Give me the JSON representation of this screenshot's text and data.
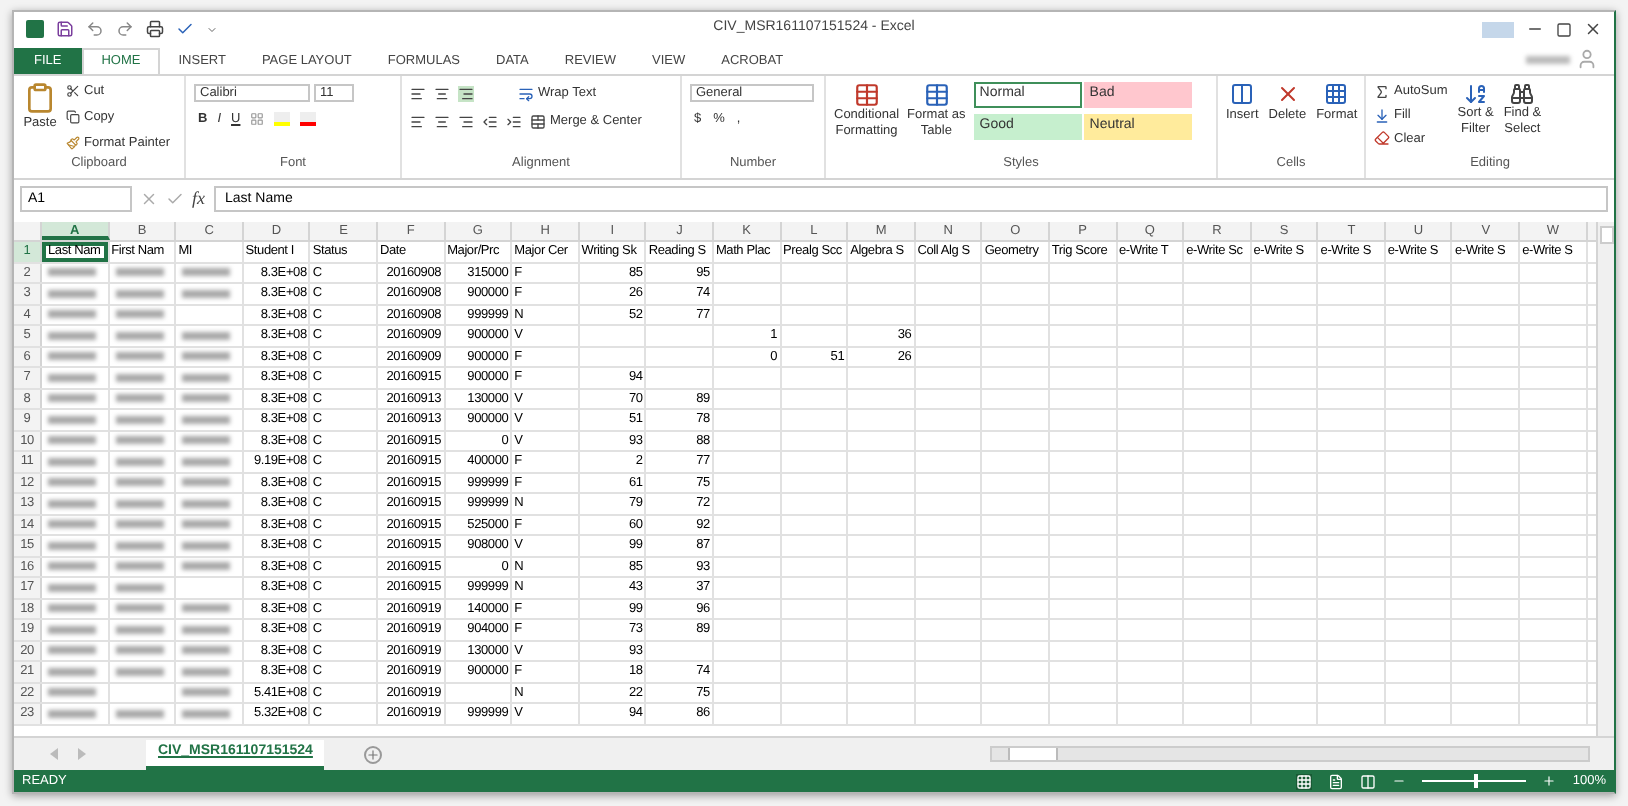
{
  "title_bar": {
    "title": "CIV_MSR161107151524 - Excel"
  },
  "ribbon_tabs": [
    {
      "label": "FILE",
      "kind": "file",
      "selected": false
    },
    {
      "label": "HOME",
      "kind": "tab",
      "selected": true
    },
    {
      "label": "INSERT",
      "kind": "tab",
      "selected": false
    },
    {
      "label": "PAGE LAYOUT",
      "kind": "tab",
      "selected": false
    },
    {
      "label": "FORMULAS",
      "kind": "tab",
      "selected": false
    },
    {
      "label": "DATA",
      "kind": "tab",
      "selected": false
    },
    {
      "label": "REVIEW",
      "kind": "tab",
      "selected": false
    },
    {
      "label": "VIEW",
      "kind": "tab",
      "selected": false
    },
    {
      "label": "ACROBAT",
      "kind": "tab",
      "selected": false
    }
  ],
  "clipboard": {
    "paste": "Paste",
    "cut": "Cut",
    "copy": "Copy",
    "format_painter": "Format Painter",
    "label": "Clipboard"
  },
  "font": {
    "name": "Calibri",
    "size": "11",
    "bold": "B",
    "italic": "I",
    "underline": "U",
    "label": "Font"
  },
  "alignment": {
    "wrap_text": "Wrap Text",
    "merge_center": "Merge & Center",
    "label": "Alignment"
  },
  "number": {
    "format": "General",
    "currency": "$",
    "percent": "%",
    "comma": ",",
    "label": "Number"
  },
  "styles": {
    "conditional": [
      "Conditional",
      "Formatting"
    ],
    "format_table": [
      "Format as",
      "Table"
    ],
    "label": "Styles",
    "cell_styles": [
      {
        "label": "Normal",
        "color": "#ffffff",
        "selected": true
      },
      {
        "label": "Bad",
        "color": "#ffc7ce",
        "selected": false
      },
      {
        "label": "Good",
        "color": "#c6efce",
        "selected": false
      },
      {
        "label": "Neutral",
        "color": "#ffeb9c",
        "selected": false
      }
    ]
  },
  "cells": {
    "buttons": [
      {
        "label": "Insert",
        "kind": "insert"
      },
      {
        "label": "Delete",
        "kind": "delete"
      },
      {
        "label": "Format",
        "kind": "format"
      }
    ],
    "label": "Cells"
  },
  "editing": {
    "autosum": "AutoSum",
    "fill": "Fill",
    "clear": "Clear",
    "sort": [
      "Sort &",
      "Filter"
    ],
    "find": [
      "Find &",
      "Select"
    ],
    "label": "Editing"
  },
  "formula_bar": {
    "name_box": "A1",
    "fx": "fx",
    "value": "Last Name"
  },
  "columns": [
    "A",
    "B",
    "C",
    "D",
    "E",
    "F",
    "G",
    "H",
    "I",
    "J",
    "K",
    "L",
    "M",
    "N",
    "O",
    "P",
    "Q",
    "R",
    "S",
    "T",
    "U",
    "V",
    "W"
  ],
  "header_row": {
    "num": "1",
    "cells": [
      {
        "text": "Last Nam",
        "selected": true
      },
      {
        "text": "First Nam",
        "selected": false
      },
      {
        "text": "MI",
        "selected": false
      },
      {
        "text": "Student I",
        "selected": false
      },
      {
        "text": "Status",
        "selected": false
      },
      {
        "text": "Date",
        "selected": false
      },
      {
        "text": "Major/Prc",
        "selected": false
      },
      {
        "text": "Major Cer",
        "selected": false
      },
      {
        "text": "Writing Sk",
        "selected": false
      },
      {
        "text": "Reading S",
        "selected": false
      },
      {
        "text": "Math Plac",
        "selected": false
      },
      {
        "text": "Prealg Scc",
        "selected": false
      },
      {
        "text": "Algebra S",
        "selected": false
      },
      {
        "text": "Coll Alg S",
        "selected": false
      },
      {
        "text": "Geometry",
        "selected": false
      },
      {
        "text": "Trig Score",
        "selected": false
      },
      {
        "text": "e-Write T",
        "selected": false
      },
      {
        "text": "e-Write Sc",
        "selected": false
      },
      {
        "text": "e-Write S",
        "selected": false
      },
      {
        "text": "e-Write S",
        "selected": false
      },
      {
        "text": "e-Write S",
        "selected": false
      },
      {
        "text": "e-Write S",
        "selected": false
      },
      {
        "text": "e-Write S",
        "selected": false
      }
    ]
  },
  "rows": [
    {
      "num": "2",
      "blur": [
        true,
        true,
        true
      ],
      "cells": {
        "D": "8.3E+08",
        "E": "C",
        "F": "20160908",
        "G": "315000",
        "H": "F",
        "I": "85",
        "J": "95"
      }
    },
    {
      "num": "3",
      "blur": [
        true,
        true,
        true
      ],
      "cells": {
        "D": "8.3E+08",
        "E": "C",
        "F": "20160908",
        "G": "900000",
        "H": "F",
        "I": "26",
        "J": "74"
      }
    },
    {
      "num": "4",
      "blur": [
        true,
        true,
        false
      ],
      "cells": {
        "D": "8.3E+08",
        "E": "C",
        "F": "20160908",
        "G": "999999",
        "H": "N",
        "I": "52",
        "J": "77"
      }
    },
    {
      "num": "5",
      "blur": [
        true,
        true,
        true
      ],
      "cells": {
        "D": "8.3E+08",
        "E": "C",
        "F": "20160909",
        "G": "900000",
        "H": "V",
        "K": "1",
        "M": "36"
      }
    },
    {
      "num": "6",
      "blur": [
        true,
        true,
        true
      ],
      "cells": {
        "D": "8.3E+08",
        "E": "C",
        "F": "20160909",
        "G": "900000",
        "H": "F",
        "K": "0",
        "L": "51",
        "M": "26"
      }
    },
    {
      "num": "7",
      "blur": [
        true,
        true,
        true
      ],
      "cells": {
        "D": "8.3E+08",
        "E": "C",
        "F": "20160915",
        "G": "900000",
        "H": "F",
        "I": "94"
      }
    },
    {
      "num": "8",
      "blur": [
        true,
        true,
        true
      ],
      "cells": {
        "D": "8.3E+08",
        "E": "C",
        "F": "20160913",
        "G": "130000",
        "H": "V",
        "I": "70",
        "J": "89"
      }
    },
    {
      "num": "9",
      "blur": [
        true,
        true,
        true
      ],
      "cells": {
        "D": "8.3E+08",
        "E": "C",
        "F": "20160913",
        "G": "900000",
        "H": "V",
        "I": "51",
        "J": "78"
      }
    },
    {
      "num": "10",
      "blur": [
        true,
        true,
        true
      ],
      "cells": {
        "D": "8.3E+08",
        "E": "C",
        "F": "20160915",
        "G": "0",
        "H": "V",
        "I": "93",
        "J": "88"
      }
    },
    {
      "num": "11",
      "blur": [
        true,
        true,
        true
      ],
      "cells": {
        "D": "9.19E+08",
        "E": "C",
        "F": "20160915",
        "G": "400000",
        "H": "F",
        "I": "2",
        "J": "77"
      }
    },
    {
      "num": "12",
      "blur": [
        true,
        true,
        true
      ],
      "cells": {
        "D": "8.3E+08",
        "E": "C",
        "F": "20160915",
        "G": "999999",
        "H": "F",
        "I": "61",
        "J": "75"
      }
    },
    {
      "num": "13",
      "blur": [
        true,
        true,
        true
      ],
      "cells": {
        "D": "8.3E+08",
        "E": "C",
        "F": "20160915",
        "G": "999999",
        "H": "N",
        "I": "79",
        "J": "72"
      }
    },
    {
      "num": "14",
      "blur": [
        true,
        true,
        true
      ],
      "cells": {
        "D": "8.3E+08",
        "E": "C",
        "F": "20160915",
        "G": "525000",
        "H": "F",
        "I": "60",
        "J": "92"
      }
    },
    {
      "num": "15",
      "blur": [
        true,
        true,
        true
      ],
      "cells": {
        "D": "8.3E+08",
        "E": "C",
        "F": "20160915",
        "G": "908000",
        "H": "V",
        "I": "99",
        "J": "87"
      }
    },
    {
      "num": "16",
      "blur": [
        true,
        true,
        true
      ],
      "cells": {
        "D": "8.3E+08",
        "E": "C",
        "F": "20160915",
        "G": "0",
        "H": "N",
        "I": "85",
        "J": "93"
      }
    },
    {
      "num": "17",
      "blur": [
        true,
        true,
        false
      ],
      "cells": {
        "D": "8.3E+08",
        "E": "C",
        "F": "20160915",
        "G": "999999",
        "H": "N",
        "I": "43",
        "J": "37"
      }
    },
    {
      "num": "18",
      "blur": [
        true,
        true,
        true
      ],
      "cells": {
        "D": "8.3E+08",
        "E": "C",
        "F": "20160919",
        "G": "140000",
        "H": "F",
        "I": "99",
        "J": "96"
      }
    },
    {
      "num": "19",
      "blur": [
        true,
        true,
        true
      ],
      "cells": {
        "D": "8.3E+08",
        "E": "C",
        "F": "20160919",
        "G": "904000",
        "H": "F",
        "I": "73",
        "J": "89"
      }
    },
    {
      "num": "20",
      "blur": [
        true,
        true,
        true
      ],
      "cells": {
        "D": "8.3E+08",
        "E": "C",
        "F": "20160919",
        "G": "130000",
        "H": "V",
        "I": "93"
      }
    },
    {
      "num": "21",
      "blur": [
        true,
        true,
        true
      ],
      "cells": {
        "D": "8.3E+08",
        "E": "C",
        "F": "20160919",
        "G": "900000",
        "H": "F",
        "I": "18",
        "J": "74"
      }
    },
    {
      "num": "22",
      "blur": [
        true,
        false,
        true
      ],
      "cells": {
        "D": "5.41E+08",
        "E": "C",
        "F": "20160919",
        "H": "N",
        "I": "22",
        "J": "75"
      }
    },
    {
      "num": "23",
      "blur": [
        true,
        true,
        true
      ],
      "cells": {
        "D": "5.32E+08",
        "E": "C",
        "F": "20160919",
        "G": "999999",
        "H": "V",
        "I": "94",
        "J": "86"
      }
    }
  ],
  "sheet_tabs": [
    {
      "label": "CIV_MSR161107151524",
      "selected": true
    }
  ],
  "status": {
    "text": "READY",
    "zoom": "100%",
    "level": 0.5
  }
}
